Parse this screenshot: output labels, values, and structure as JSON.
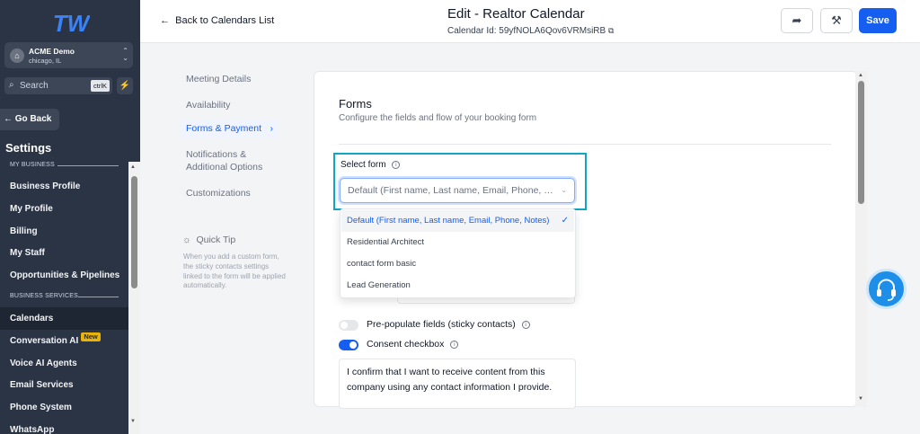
{
  "sidebar": {
    "account_name": "ACME Demo",
    "account_location": "chicago, IL",
    "search_placeholder": "Search",
    "search_shortcut": "ctrlK",
    "go_back": "Go Back",
    "settings_title": "Settings",
    "section_my_business": "MY BUSINESS",
    "section_business_services": "BUSINESS SERVICES",
    "items_business": [
      "Business Profile",
      "My Profile",
      "Billing",
      "My Staff",
      "Opportunities & Pipelines"
    ],
    "items_services": [
      "Calendars",
      "Conversation AI",
      "Voice AI Agents",
      "Email Services",
      "Phone System",
      "WhatsApp"
    ],
    "new_badge": "New",
    "active_item": "Calendars"
  },
  "header": {
    "back_label": "Back to Calendars List",
    "title": "Edit - Realtor Calendar",
    "calendar_id": "Calendar Id: 59yfNOLA6Qov6VRMsiRB",
    "save_label": "Save"
  },
  "subnav": {
    "items": [
      "Meeting Details",
      "Availability",
      "Forms & Payment",
      "Notifications &",
      "Additional Options",
      "Customizations"
    ],
    "active": "Forms & Payment",
    "tip_title": "Quick Tip",
    "tip_text": "When you add a custom form, the sticky contacts settings linked to the form will be applied automatically."
  },
  "forms": {
    "title": "Forms",
    "description": "Configure the fields and flow of your booking form",
    "select_label": "Select form",
    "select_value": "Default (First name, Last name, Email, Phone, Notes)",
    "options": [
      "Default (First name, Last name, Email, Phone, Notes)",
      "Residential Architect",
      "contact form basic",
      "Lead Generation"
    ],
    "selected_index": 0,
    "prepopulate_label": "Pre-populate fields (sticky contacts)",
    "prepopulate_on": false,
    "consent_label": "Consent checkbox",
    "consent_on": true,
    "consent_text": "I confirm that I want to receive content from this company using any contact information I provide."
  },
  "colors": {
    "primary": "#155eef",
    "highlight": "#10a5c0",
    "sidebar_bg": "#2b3445"
  }
}
